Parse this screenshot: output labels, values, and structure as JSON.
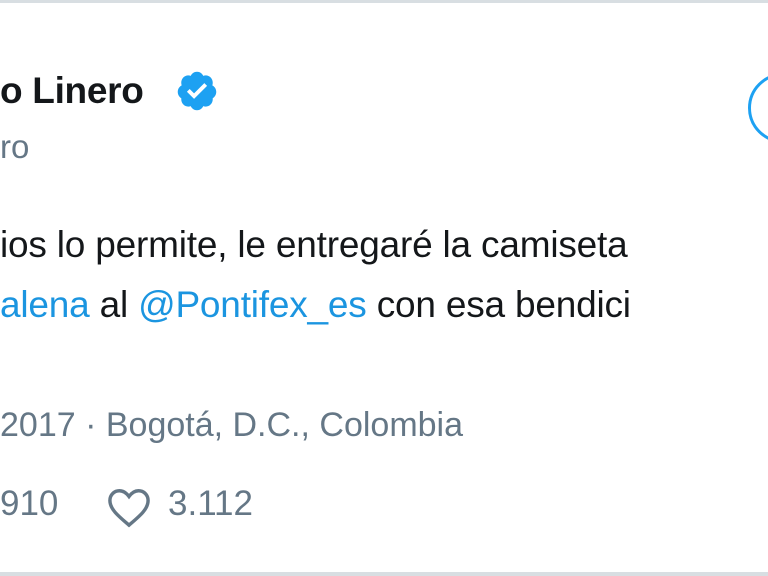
{
  "tweet": {
    "display_name": "o Linero",
    "handle": "ro",
    "verified_icon": "verified-badge-icon",
    "text_line1": "ios lo permite, le entregaré la camiseta",
    "text_line2_prefix": "alena",
    "text_line2_mid": " al ",
    "text_line2_mention": "@Pontifex_es",
    "text_line2_suffix": " con esa bendici",
    "meta": "2017 · Bogotá, D.C., Colombia",
    "retweets": "910",
    "likes": "3.112",
    "like_icon": "heart-icon"
  },
  "colors": {
    "link": "#1b95e0",
    "verified": "#1da1f2",
    "muted": "#657786",
    "text": "#14171a"
  }
}
